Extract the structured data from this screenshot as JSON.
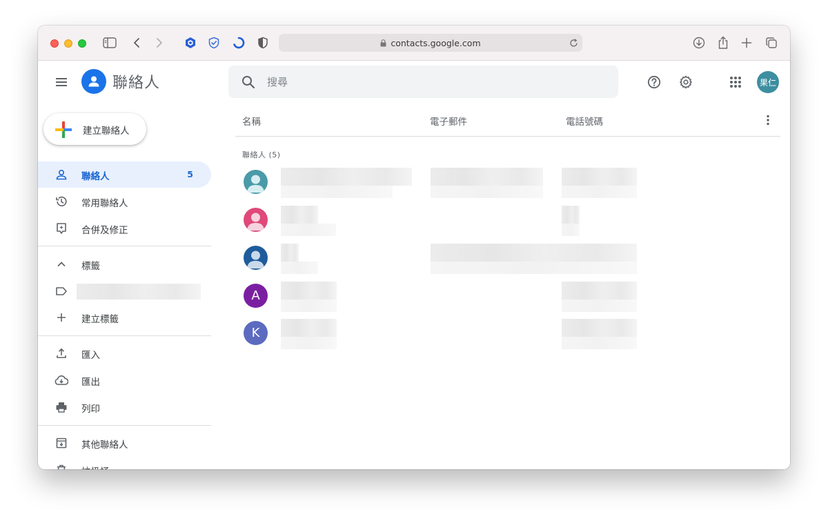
{
  "browser": {
    "url": "contacts.google.com"
  },
  "app": {
    "title": "聯絡人"
  },
  "search": {
    "placeholder": "搜尋"
  },
  "user": {
    "avatar_text": "果仁",
    "avatar_color": "#3d8ea0"
  },
  "sidebar": {
    "create_label": "建立聯絡人",
    "items": [
      {
        "label": "聯絡人",
        "count": "5",
        "icon": "person-icon",
        "active": true
      },
      {
        "label": "常用聯絡人",
        "icon": "history-icon"
      },
      {
        "label": "合併及修正",
        "icon": "merge-fix-icon"
      }
    ],
    "labels_section": {
      "label": "標籤",
      "create_label": "建立標籤"
    },
    "tools": [
      {
        "label": "匯入",
        "icon": "upload-icon"
      },
      {
        "label": "匯出",
        "icon": "cloud-download-icon"
      },
      {
        "label": "列印",
        "icon": "printer-icon"
      }
    ],
    "other": [
      {
        "label": "其他聯絡人",
        "icon": "archive-icon"
      },
      {
        "label": "垃圾桶",
        "icon": "trash-icon"
      }
    ]
  },
  "table": {
    "columns": {
      "name": "名稱",
      "email": "電子郵件",
      "phone": "電話號碼"
    },
    "section_label": "聯絡人 (5)",
    "rows": [
      {
        "avatar": "person-avatar",
        "color": "#4a9aa8"
      },
      {
        "avatar": "person-avatar",
        "color": "#e0497a"
      },
      {
        "avatar": "person-avatar",
        "color": "#1f5c9c"
      },
      {
        "avatar_letter": "A",
        "color": "#7b1fa2"
      },
      {
        "avatar_letter": "K",
        "color": "#5c6bc0"
      }
    ]
  },
  "colors": {
    "accent": "#1a73e8",
    "active_bg": "#e8f0fe",
    "active_text": "#1967d2"
  }
}
